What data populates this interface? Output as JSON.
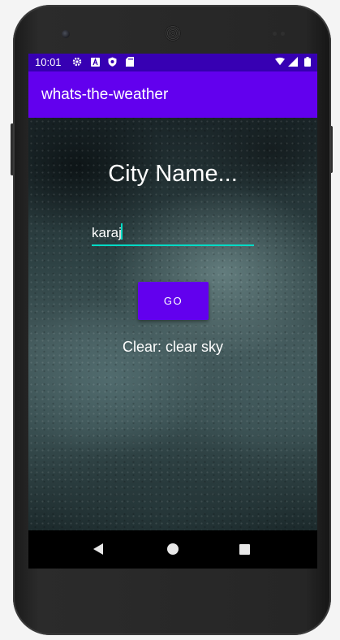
{
  "status_bar": {
    "time": "10:01",
    "icons": [
      "gear-icon",
      "a-icon",
      "shield-icon",
      "sd-card-icon",
      "wifi-icon",
      "signal-icon",
      "battery-icon"
    ]
  },
  "app_bar": {
    "title": "whats-the-weather"
  },
  "main": {
    "heading": "City Name...",
    "city_input": {
      "value": "karaj"
    },
    "go_button_label": "GO",
    "result_text": "Clear: clear sky"
  },
  "colors": {
    "status_bar": "#3700b3",
    "app_bar": "#6200ee",
    "button": "#6200ee",
    "input_underline": "#03dac5"
  },
  "nav_bar": {
    "icons": [
      "back-icon",
      "home-icon",
      "recents-icon"
    ]
  }
}
